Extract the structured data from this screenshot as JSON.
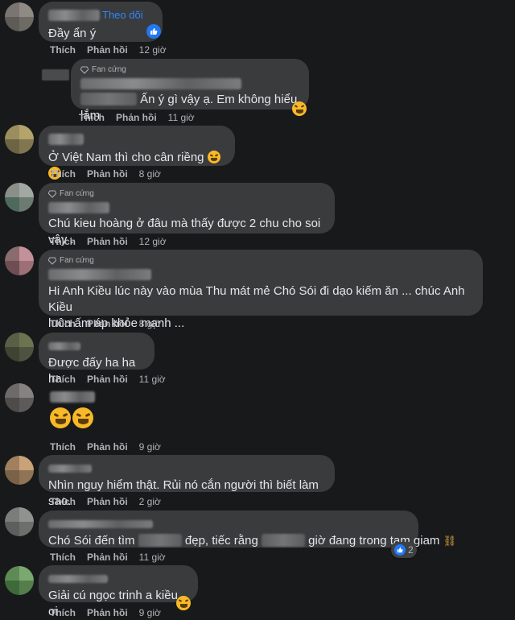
{
  "labels": {
    "like": "Thích",
    "reply": "Phản hồi",
    "fan": "Fan cứng",
    "follow": "Theo dõi"
  },
  "comments": [
    {
      "text": "Đầy ẩn ý",
      "time": "12 giờ",
      "follow": "Theo dõi",
      "reaction": "like"
    },
    {
      "text": "Ấn ý gì vậy ạ. Em không hiểu lắm",
      "time": "11 giờ",
      "badge": "Fan cứng",
      "reply": true,
      "emoji": "grin"
    },
    {
      "text": "Ở Việt Nam thì cho cân riềng",
      "time": "8 giờ",
      "emoji": "rofl x2"
    },
    {
      "text": "Chú kieu hoàng ở đâu mà thấy được 2 chu cho soi vậy .",
      "time": "12 giờ",
      "badge": "Fan cứng"
    },
    {
      "text_line1": "Hi Anh Kiều lúc này vào mùa Thu mát mẻ Chó Sói đi dạo kiếm ăn ... chúc Anh Kiều",
      "text_line2": "luôn ấm áp khỏe mạnh ...",
      "time": "8 giờ",
      "badge": "Fan cứng"
    },
    {
      "text": "Được đấy ha ha ha",
      "time": "11 giờ"
    },
    {
      "text": "",
      "time": "9 giờ",
      "emoji": "rofl x2"
    },
    {
      "text": "Nhìn nguy hiểm thật. Rủi nó cắn người thì biết làm sao.",
      "time": "2 giờ"
    },
    {
      "text_a": "Chó Sói đến tìm",
      "text_b": "đẹp, tiếc rằng",
      "text_c": "giờ đang trong tạm giam",
      "time": "11 giờ",
      "reaction_count": "2"
    },
    {
      "text": "Giải cú ngọc trinh a kiều oi",
      "time": "9 giờ",
      "emoji": "grin"
    }
  ],
  "colors": {
    "bubble": "#3a3b3c",
    "background": "#18191a",
    "link": "#2d88ff",
    "like": "#2078f4"
  }
}
